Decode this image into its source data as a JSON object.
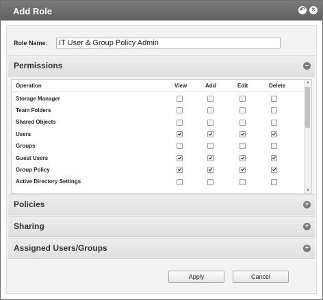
{
  "dialog": {
    "title": "Add Role"
  },
  "role": {
    "label": "Role Name:",
    "value": "IT User & Group Policy Admin"
  },
  "sections": {
    "permissions": "Permissions",
    "policies": "Policies",
    "sharing": "Sharing",
    "assigned": "Assigned Users/Groups"
  },
  "permissions_table": {
    "columns": [
      "Operation",
      "View",
      "Add",
      "Edit",
      "Delete"
    ],
    "rows": [
      {
        "operation": "Storage Manager",
        "view": false,
        "add": false,
        "edit": false,
        "delete": false
      },
      {
        "operation": "Team Folders",
        "view": false,
        "add": false,
        "edit": false,
        "delete": false
      },
      {
        "operation": "Shared Objects",
        "view": false,
        "add": false,
        "edit": false,
        "delete": false
      },
      {
        "operation": "Users",
        "view": true,
        "add": true,
        "edit": true,
        "delete": true
      },
      {
        "operation": "Groups",
        "view": false,
        "add": false,
        "edit": false,
        "delete": false
      },
      {
        "operation": "Guest Users",
        "view": true,
        "add": true,
        "edit": true,
        "delete": true
      },
      {
        "operation": "Group Policy",
        "view": true,
        "add": true,
        "edit": true,
        "delete": true
      },
      {
        "operation": "Active Directory Settings",
        "view": false,
        "add": false,
        "edit": false,
        "delete": false
      }
    ]
  },
  "buttons": {
    "apply": "Apply",
    "cancel": "Cancel"
  },
  "icons": {
    "title_back": "back-circle-icon",
    "title_close": "close-circle-icon",
    "collapse": "minus-circle-icon",
    "expand": "plus-circle-icon"
  }
}
